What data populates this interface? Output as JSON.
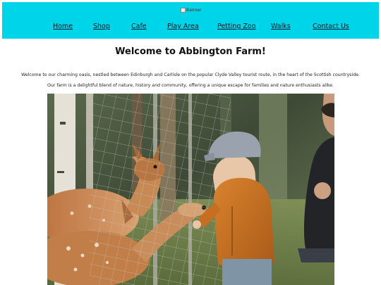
{
  "header": {
    "banner_alt": "Banner",
    "nav": [
      "Home",
      "Shop",
      "Cafe",
      "Play Area",
      "Petting Zoo",
      "Walks",
      "Contact Us"
    ]
  },
  "main": {
    "title": "Welcome to Abbington Farm!",
    "intro_lines": [
      "Welcome to our charming oasis, nestled between Edinburgh and Carlisle on the popular Clyde Valley tourist route, in the heart of the Scottish countryside.",
      "Our farm is a delightful blend of nature, history and community, offering a unique escape for families and nature enthusiasts alike."
    ]
  },
  "colors": {
    "header_bg": "#00d4e9",
    "nav_text": "#0d1a26"
  },
  "icons": {
    "banner": "broken-image-icon"
  }
}
